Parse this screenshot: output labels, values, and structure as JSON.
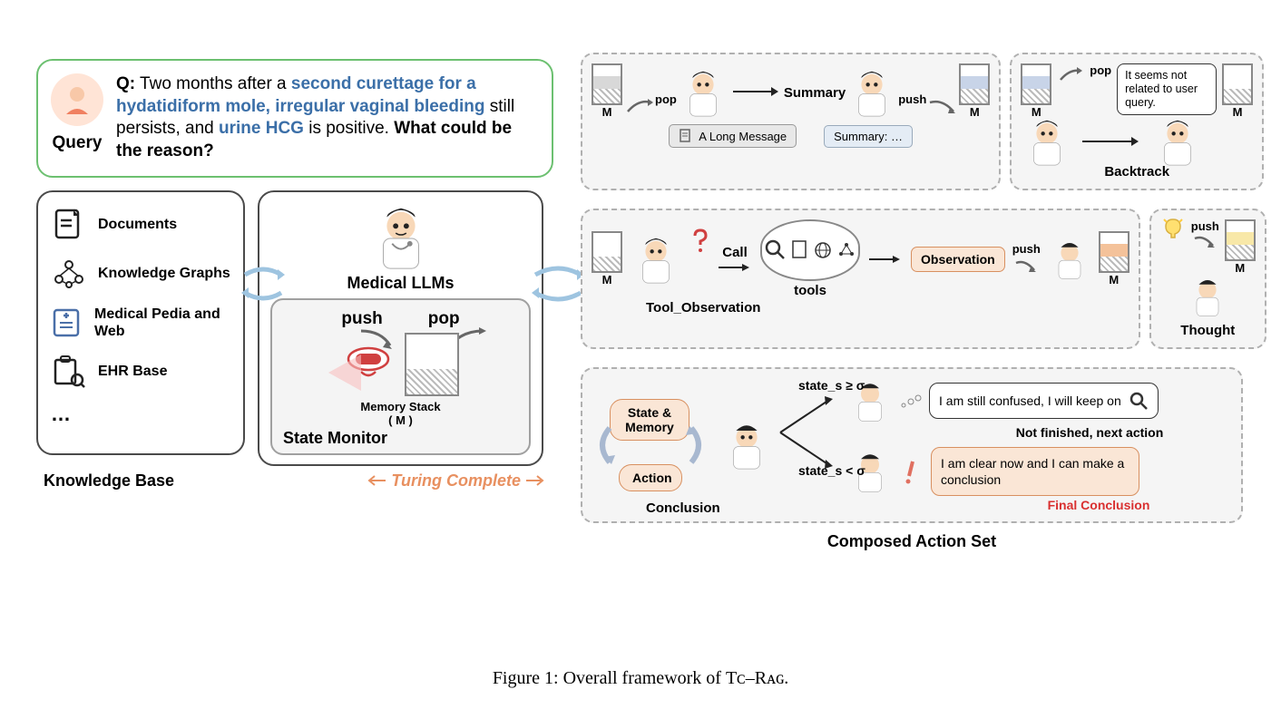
{
  "query": {
    "label": "Query",
    "prefix": "Q:",
    "text_parts": {
      "p1": " Two months after a ",
      "h1": "second curettage for a hydatidiform mole, irregular vaginal bleeding",
      "p2": " still persists, and ",
      "h2": "urine HCG",
      "p3": " is positive. ",
      "bold_q": "What could be the reason?"
    }
  },
  "knowledge_base": {
    "title": "Knowledge Base",
    "items": [
      {
        "icon": "document-icon",
        "label": "Documents"
      },
      {
        "icon": "graph-icon",
        "label": "Knowledge Graphs"
      },
      {
        "icon": "book-icon",
        "label": "Medical Pedia and Web"
      },
      {
        "icon": "ehr-icon",
        "label": "EHR Base"
      },
      {
        "icon": "ellipsis",
        "label": "…"
      }
    ]
  },
  "llm": {
    "title": "Medical LLMs",
    "state_monitor": {
      "title": "State Monitor",
      "push": "push",
      "pop": "pop",
      "memory_stack": "Memory Stack",
      "memory_var": "( M )"
    }
  },
  "turing": "Turing Complete",
  "actions": {
    "set_label": "Composed Action Set",
    "summary": {
      "label": "Summary",
      "pop": "pop",
      "push": "push",
      "long_msg": "A Long Message",
      "summary_chip": "Summary: …",
      "m": "M"
    },
    "backtrack": {
      "label": "Backtrack",
      "pop": "pop",
      "bubble": "It seems not related to user query.",
      "m": "M"
    },
    "tool_observation": {
      "label": "Tool_Observation",
      "call": "Call",
      "tools": "tools",
      "observation": "Observation",
      "push": "push",
      "m": "M"
    },
    "thought": {
      "label": "Thought",
      "push": "push",
      "m": "M"
    },
    "conclusion": {
      "label": "Conclusion",
      "state_memory": "State & Memory",
      "action": "Action",
      "cond_ge": "state_s ≥ σ",
      "cond_lt": "state_s < σ",
      "bubble1": "I am still confused, I will keep on",
      "not_finished": "Not finished, next action",
      "bubble2": "I am clear now and I can make a conclusion",
      "final": "Final Conclusion"
    }
  },
  "caption_prefix": "Figure 1: Overall framework of ",
  "caption_name1": "Tᴄ",
  "caption_dash": "–",
  "caption_name2": "Rᴀɢ",
  "caption_suffix": "."
}
